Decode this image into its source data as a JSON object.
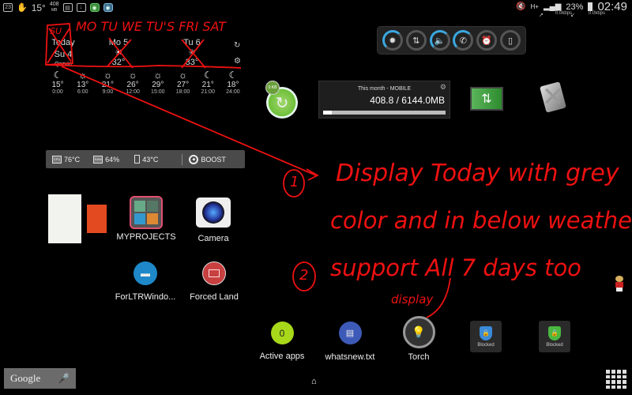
{
  "status_bar": {
    "left_icons": [
      "battery-23-icon",
      "hand-icon",
      "weather-temp",
      "ram-indicator",
      "clipboard-icon",
      "download-icon",
      "shield-green-icon",
      "shield-blue-icon"
    ],
    "temperature": "15°",
    "ram": "408",
    "ram_unit": "MB",
    "battery_percent": "23%",
    "clock": "02:49",
    "network": "H+",
    "upload_speed": "0.0kbps",
    "download_speed": "0.0kbps"
  },
  "weather": {
    "days": [
      {
        "name": "Today",
        "date": "Su 4",
        "location": "Qazvin"
      },
      {
        "name": "Mo 5",
        "icon": "sun-cloud-icon",
        "temp": "32°"
      },
      {
        "name": "Tu 6",
        "icon": "sun-cloud-icon",
        "temp": "33°"
      }
    ],
    "hourly": [
      {
        "icon": "☾",
        "temp": "15°",
        "hour": "0:00"
      },
      {
        "icon": "☼",
        "temp": "13°",
        "hour": "6:00"
      },
      {
        "icon": "☼",
        "temp": "21°",
        "hour": "9:00"
      },
      {
        "icon": "☼",
        "temp": "26°",
        "hour": "12:00"
      },
      {
        "icon": "☼",
        "temp": "29°",
        "hour": "15:00"
      },
      {
        "icon": "☼",
        "temp": "27°",
        "hour": "18:00"
      },
      {
        "icon": "☾",
        "temp": "21°",
        "hour": "21:00"
      },
      {
        "icon": "☾",
        "temp": "18°",
        "hour": "24:00"
      }
    ]
  },
  "sysbar": {
    "cpu": "76°C",
    "ram": "64%",
    "battery_temp": "43°C",
    "boost_label": "BOOST"
  },
  "toggles": [
    {
      "name": "auto-brightness",
      "glyph": "✹",
      "on": true
    },
    {
      "name": "data-off",
      "glyph": "⇅",
      "on": false
    },
    {
      "name": "sound",
      "glyph": "🔈",
      "on": true
    },
    {
      "name": "call",
      "glyph": "✆",
      "on": true
    },
    {
      "name": "alarm",
      "glyph": "⏰",
      "on": false
    },
    {
      "name": "rotation",
      "glyph": "▯",
      "on": false
    }
  ],
  "data_usage": {
    "title": "This month - MOBILE",
    "value": "408.8 / 6144.0MB",
    "progress": 0.07
  },
  "cleaner_badge": "0 KB",
  "apps": {
    "myprojects": "MYPROJECTS",
    "camera": "Camera",
    "forltr": "ForLTRWindo...",
    "forced_land": "Forced Land",
    "active_apps": "Active apps",
    "active_count": "0",
    "whatsnew": "whatsnew.txt",
    "torch": "Torch",
    "blocked1": "Blocked",
    "blocked2": "Blocked"
  },
  "google_search": {
    "label": "Google"
  },
  "annotations": {
    "days_header": "MO TU WE TU'S FRI SAT",
    "today_mark": "SU",
    "note1_num": "1",
    "note1_line1": "Display Today with grey",
    "note1_line2": "color and in below weather",
    "note2_num": "2",
    "note2_line": "support All 7 days too",
    "display_word": "display"
  }
}
